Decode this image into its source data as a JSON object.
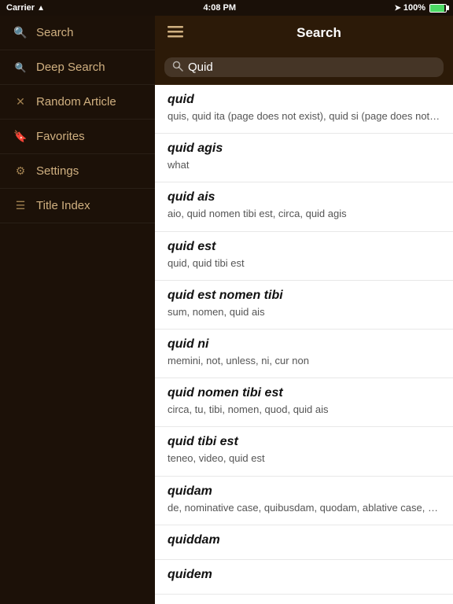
{
  "statusBar": {
    "carrier": "Carrier",
    "time": "4:08 PM",
    "signal": "100%"
  },
  "sidebar": {
    "items": [
      {
        "id": "search",
        "label": "Search",
        "icon": "🔍"
      },
      {
        "id": "deep-search",
        "label": "Deep Search",
        "icon": "🔍"
      },
      {
        "id": "random-article",
        "label": "Random Article",
        "icon": "✕"
      },
      {
        "id": "favorites",
        "label": "Favorites",
        "icon": "🔖"
      },
      {
        "id": "settings",
        "label": "Settings",
        "icon": "⚙"
      },
      {
        "id": "title-index",
        "label": "Title Index",
        "icon": "☰"
      }
    ]
  },
  "header": {
    "title": "Search",
    "menuIcon": "menu"
  },
  "searchBar": {
    "value": "Quid",
    "placeholder": "Search"
  },
  "results": [
    {
      "title": "quid",
      "description": "quis, quid ita (page does not exist), quid si (page does not exist), ca cosa (page does not exist), qui ("
    },
    {
      "title": "quid agis",
      "description": "what"
    },
    {
      "title": "quid ais",
      "description": "aio, quid nomen tibi est, circa, quid agis"
    },
    {
      "title": "quid est",
      "description": "quid, quid tibi est"
    },
    {
      "title": "quid est nomen tibi",
      "description": "sum, nomen, quid ais"
    },
    {
      "title": "quid ni",
      "description": "memini, not, unless, ni, cur non"
    },
    {
      "title": "quid nomen tibi est",
      "description": "circa, tu, tibi, nomen, quod, quid ais"
    },
    {
      "title": "quid tibi est",
      "description": "teneo, video, quid est"
    },
    {
      "title": "quidam",
      "description": "de, nominative case, quibusdam, quodam, ablative case, quorundam, quaedam, dative case, cujusdan"
    },
    {
      "title": "quiddam",
      "description": ""
    },
    {
      "title": "quidem",
      "description": ""
    }
  ]
}
